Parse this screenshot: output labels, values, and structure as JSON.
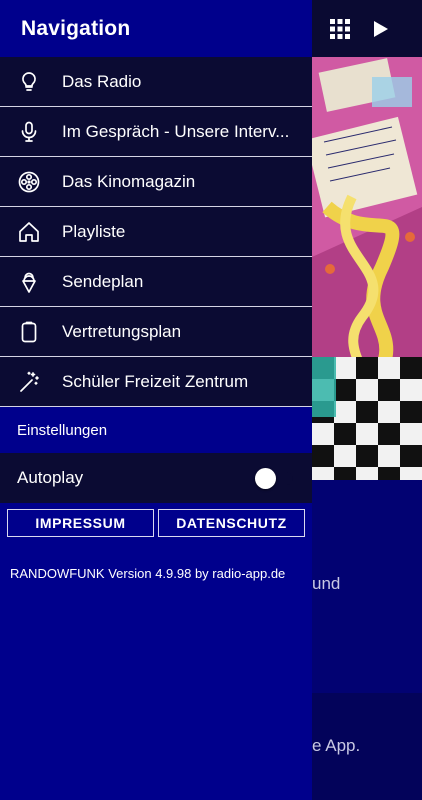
{
  "drawer": {
    "title": "Navigation",
    "items": [
      {
        "label": "Das Radio",
        "icon": "lightbulb-icon"
      },
      {
        "label": "Im Gespräch - Unsere Interv...",
        "icon": "microphone-icon"
      },
      {
        "label": "Das Kinomagazin",
        "icon": "film-reel-icon"
      },
      {
        "label": "Playliste",
        "icon": "home-icon"
      },
      {
        "label": "Sendeplan",
        "icon": "ice-cream-icon"
      },
      {
        "label": "Vertretungsplan",
        "icon": "clipboard-icon"
      },
      {
        "label": "Schüler Freizeit Zentrum",
        "icon": "magic-wand-icon"
      }
    ],
    "settings_header": "Einstellungen",
    "autoplay_label": "Autoplay",
    "autoplay_on": false,
    "impressum_label": "IMPRESSUM",
    "datenschutz_label": "DATENSCHUTZ",
    "version_text": "RANDOWFUNK Version 4.9.98 by radio-app.de"
  },
  "background": {
    "text_1": "und",
    "text_2": "e App.",
    "icons": [
      "grid-icon",
      "play-icon"
    ]
  },
  "colors": {
    "drawer_bg": "#00008c",
    "item_bg": "#0b0b33",
    "divider": "#d4d4e4",
    "text": "#ffffff"
  }
}
